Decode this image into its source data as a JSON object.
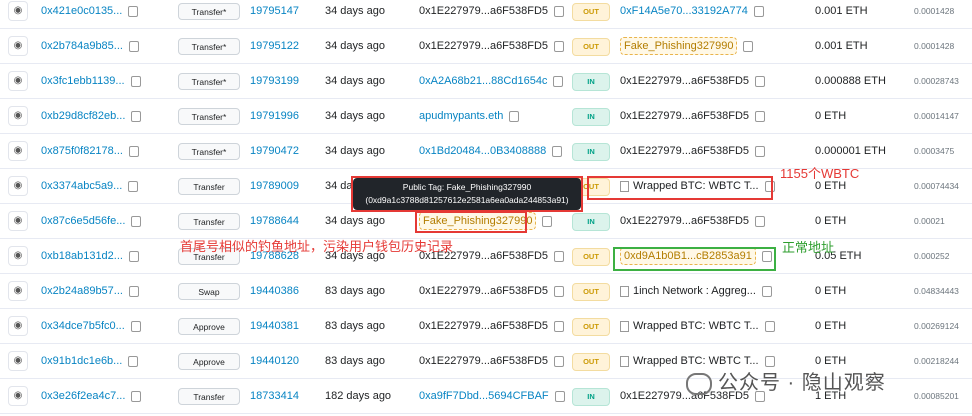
{
  "rows": [
    {
      "hash": "0x421e0c0135...",
      "method": "Transfer*",
      "block": "19795147",
      "age": "34 days ago",
      "from": "0x1E227979...a6F538FD5",
      "dir": "OUT",
      "to": "0xF14A5e70...33192A774",
      "to_style": "link",
      "value": "0.001 ETH",
      "fee": "0.0001428"
    },
    {
      "hash": "0x2b784a9b85...",
      "method": "Transfer*",
      "block": "19795122",
      "age": "34 days ago",
      "from": "0x1E227979...a6F538FD5",
      "dir": "OUT",
      "to": "Fake_Phishing327990",
      "to_style": "tag",
      "value": "0.001 ETH",
      "fee": "0.0001428"
    },
    {
      "hash": "0x3fc1ebb1139...",
      "method": "Transfer*",
      "block": "19793199",
      "age": "34 days ago",
      "from": "0xA2A68b21...88Cd1654c",
      "from_style": "link",
      "dir": "IN",
      "to": "0x1E227979...a6F538FD5",
      "value": "0.000888 ETH",
      "fee": "0.00028743"
    },
    {
      "hash": "0xb29d8cf82eb...",
      "method": "Transfer*",
      "block": "19791996",
      "age": "34 days ago",
      "from": "apudmypants.eth",
      "from_style": "link",
      "dir": "IN",
      "to": "0x1E227979...a6F538FD5",
      "value": "0 ETH",
      "fee": "0.00014147"
    },
    {
      "hash": "0x875f0f82178...",
      "method": "Transfer*",
      "block": "19790472",
      "age": "34 days ago",
      "from": "0x1Bd20484...0B3408888",
      "from_style": "link",
      "dir": "IN",
      "to": "0x1E227979...a6F538FD5",
      "value": "0.000001 ETH",
      "fee": "0.0003475"
    },
    {
      "hash": "0x3374abc5a9...",
      "method": "Transfer",
      "block": "19789009",
      "age": "34 days ago",
      "from": "",
      "dir": "OUT",
      "to": "Wrapped BTC: WBTC T...",
      "to_style": "doc",
      "value": "0 ETH",
      "fee": "0.00074434"
    },
    {
      "hash": "0x87c6e5d56fe...",
      "method": "Transfer",
      "block": "19788644",
      "age": "34 days ago",
      "from": "Fake_Phishing327990",
      "from_style": "tag",
      "dir": "IN",
      "to": "0x1E227979...a6F538FD5",
      "value": "0 ETH",
      "fee": "0.00021"
    },
    {
      "hash": "0xb18ab131d2...",
      "method": "Transfer",
      "block": "19788628",
      "age": "34 days ago",
      "from": "0x1E227979...a6F538FD5",
      "dir": "OUT",
      "to": "0xd9A1b0B1...cB2853a91",
      "to_style": "tag",
      "value": "0.05 ETH",
      "fee": "0.000252"
    },
    {
      "hash": "0x2b24a89b57...",
      "method": "Swap",
      "block": "19440386",
      "age": "83 days ago",
      "from": "0x1E227979...a6F538FD5",
      "dir": "OUT",
      "to": "1inch Network : Aggreg...",
      "to_style": "doc",
      "value": "0 ETH",
      "fee": "0.04834443"
    },
    {
      "hash": "0x34dce7b5fc0...",
      "method": "Approve",
      "block": "19440381",
      "age": "83 days ago",
      "from": "0x1E227979...a6F538FD5",
      "dir": "OUT",
      "to": "Wrapped BTC: WBTC T...",
      "to_style": "doc",
      "value": "0 ETH",
      "fee": "0.00269124"
    },
    {
      "hash": "0x91b1dc1e6b...",
      "method": "Approve",
      "block": "19440120",
      "age": "83 days ago",
      "from": "0x1E227979...a6F538FD5",
      "dir": "OUT",
      "to": "Wrapped BTC: WBTC T...",
      "to_style": "doc",
      "value": "0 ETH",
      "fee": "0.00218244"
    },
    {
      "hash": "0x3e26f2ea4c7...",
      "method": "Transfer",
      "block": "18733414",
      "age": "182 days ago",
      "from": "0xa9fF7Dbd...5694CFBAF",
      "from_style": "link",
      "dir": "IN",
      "to": "0x1E227979...a6F538FD5",
      "value": "1 ETH",
      "fee": "0.00085201"
    }
  ],
  "tooltip": {
    "line1": "Public Tag: Fake_Phishing327990",
    "line2": "(0xd9a1c3788d81257612e2581a6ea0ada244853a91)"
  },
  "annotations": {
    "wbtc_amount": "1155个WBTC",
    "normal_address": "正常地址",
    "phishing_note": "首尾号相似的钓鱼地址，污染用户钱包历史记录"
  },
  "watermark": "公众号 · 隐山观察",
  "colors": {
    "link": "#0784c3",
    "out_badge": "#cc9a06",
    "in_badge": "#00a186",
    "annotation_red": "#e53935",
    "annotation_green": "#2e9e2e"
  }
}
